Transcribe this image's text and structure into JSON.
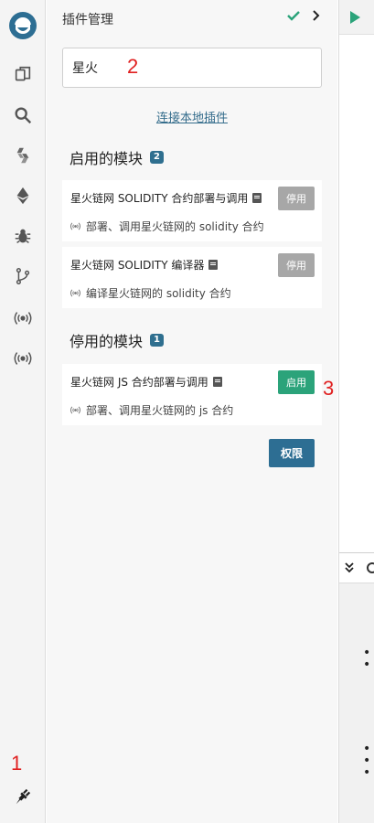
{
  "rail": {
    "icons": [
      "logo-icon",
      "file-explorer-icon",
      "search-icon",
      "solidity-compiler-icon",
      "deploy-run-icon",
      "debugger-icon",
      "git-icon",
      "plugin-broadcast-icon",
      "plugin-broadcast-icon-2",
      "plugin-manager-icon"
    ]
  },
  "annotations": {
    "n1": "1",
    "n2": "2",
    "n3": "3"
  },
  "panel": {
    "title": "插件管理",
    "search_value": "星火",
    "connect_link": "连接本地插件",
    "active": {
      "title": "启用的模块",
      "count": "2",
      "modules": [
        {
          "name": "星火链网 SOLIDITY 合约部署与调用",
          "desc": "部署、调用星火链网的 solidity 合约",
          "button": "停用"
        },
        {
          "name": "星火链网 SOLIDITY 编译器",
          "desc": "编译星火链网的 solidity 合约",
          "button": "停用"
        }
      ]
    },
    "inactive": {
      "title": "停用的模块",
      "count": "1",
      "modules": [
        {
          "name": "星火链网 JS 合约部署与调用",
          "desc": "部署、调用星火链网的 js 合约",
          "button": "启用"
        }
      ]
    },
    "permissions_button": "权限"
  },
  "colors": {
    "accent": "#2d6e93",
    "enable_green": "#2ba37a",
    "disable_gray": "#a7a7a7",
    "annotation_red": "#e02020"
  }
}
